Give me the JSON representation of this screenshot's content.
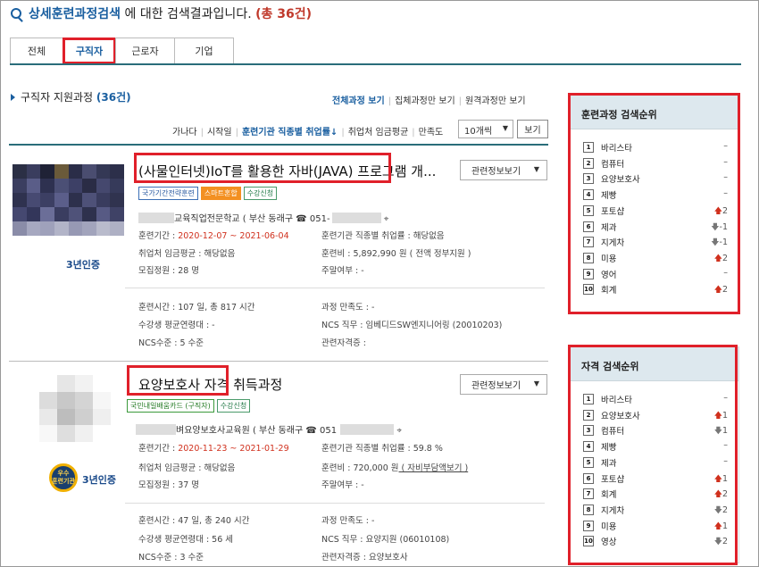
{
  "header": {
    "keyword": "상세훈련과정검색",
    "middle": " 에 대한 검색결과입니다. ",
    "count": "(총 36건)"
  },
  "tabs": [
    {
      "label": "전체"
    },
    {
      "label": "구직자"
    },
    {
      "label": "근로자"
    },
    {
      "label": "기업"
    }
  ],
  "section": {
    "title_prefix": "구직자 지원과정 ",
    "title_count": "(36건)"
  },
  "view_links": {
    "all": "전체과정 보기",
    "group": "집체과정만 보기",
    "remote": "원격과정만 보기"
  },
  "sort_links": {
    "items": [
      "가나다",
      "시작일",
      "훈련기관 직종별 취업률↓",
      "취업처 임금평균",
      "만족도"
    ],
    "page_size": "10개씩",
    "view_button": "보기"
  },
  "results": [
    {
      "title": "(사물인터넷)IoT를 활용한 자바(JAVA) 프로그램 개...",
      "related_button": "관련정보보기",
      "tags": [
        "국가기간전략훈련",
        "스마트혼합",
        "수강신청"
      ],
      "inst": "교육직업전문학교 ( 부산 동래구 ☎ 051-",
      "cert": "3년인증",
      "period_label": "훈련기간 : ",
      "period": "2020-12-07 ~ 2021-06-04",
      "employ_label": "훈련기관 직종별 취업률 : ",
      "employ": "해당없음",
      "wage": "취업처 임금평균 : 해당없음",
      "fee_label": "훈련비 : ",
      "fee": "5,892,990 원",
      "fee_note": " ( 전액 정부지원 )",
      "capacity": "모집정원 : 28 명",
      "weekend": "주말여부 : -",
      "hours": "훈련시간 : 107 일, 총 817 시간",
      "satisfaction": "과정 만족도 : -",
      "age": "수강생 평균연령대 : -",
      "ncs_job": "NCS 직무 : 임베디드SW엔지니어링 (20010203)",
      "ncs_level": "NCS수준 : 5 수준",
      "license": "관련자격증 :"
    },
    {
      "title": "요양보호사 자격 취득과정",
      "related_button": "관련정보보기",
      "tags": [
        "국민내일배움카드 (구직자)",
        "수강신청"
      ],
      "inst": "벼요양보호사교육원 ( 부산 동래구 ☎ 051",
      "cert": "3년인증",
      "seal": "우수\n훈련기관",
      "period_label": "훈련기간 : ",
      "period": "2020-11-23 ~ 2021-01-29",
      "employ_label": "훈련기관 직종별 취업률 : ",
      "employ": "59.8 %",
      "wage": "취업처 임금평균 : 해당없음",
      "fee_label": "훈련비 : ",
      "fee": "720,000 원",
      "fee_note": " ( 자비부담액보기 )",
      "capacity": "모집정원 : 37 명",
      "weekend": "주말여부 : -",
      "hours": "훈련시간 : 47 일, 총 240 시간",
      "satisfaction": "과정 만족도 : -",
      "age": "수강생 평균연령대 : 56 세",
      "ncs_job": "NCS 직무 : 요양지원 (06010108)",
      "ncs_level": "NCS수준 : 3 수준",
      "license": "관련자격증 : 요양보호사"
    }
  ],
  "course_rank": {
    "title": "훈련과정 검색순위",
    "items": [
      {
        "n": "1",
        "name": "바리스타",
        "chg": "–",
        "dir": "none"
      },
      {
        "n": "2",
        "name": "컴퓨터",
        "chg": "–",
        "dir": "none"
      },
      {
        "n": "3",
        "name": "요양보호사",
        "chg": "–",
        "dir": "none"
      },
      {
        "n": "4",
        "name": "제빵",
        "chg": "–",
        "dir": "none"
      },
      {
        "n": "5",
        "name": "포토샵",
        "chg": "2",
        "dir": "up"
      },
      {
        "n": "6",
        "name": "제과",
        "chg": "-1",
        "dir": "dn"
      },
      {
        "n": "7",
        "name": "지게차",
        "chg": "-1",
        "dir": "dn"
      },
      {
        "n": "8",
        "name": "미용",
        "chg": "2",
        "dir": "up"
      },
      {
        "n": "9",
        "name": "영어",
        "chg": "–",
        "dir": "none"
      },
      {
        "n": "10",
        "name": "회계",
        "chg": "2",
        "dir": "up"
      }
    ]
  },
  "cert_rank": {
    "title": "자격 검색순위",
    "items": [
      {
        "n": "1",
        "name": "바리스타",
        "chg": "–",
        "dir": "none"
      },
      {
        "n": "2",
        "name": "요양보호사",
        "chg": "1",
        "dir": "up"
      },
      {
        "n": "3",
        "name": "컴퓨터",
        "chg": "1",
        "dir": "dn"
      },
      {
        "n": "4",
        "name": "제빵",
        "chg": "–",
        "dir": "none"
      },
      {
        "n": "5",
        "name": "제과",
        "chg": "–",
        "dir": "none"
      },
      {
        "n": "6",
        "name": "포토샵",
        "chg": "1",
        "dir": "up"
      },
      {
        "n": "7",
        "name": "회계",
        "chg": "2",
        "dir": "up"
      },
      {
        "n": "8",
        "name": "지게차",
        "chg": "2",
        "dir": "dn"
      },
      {
        "n": "9",
        "name": "미용",
        "chg": "1",
        "dir": "up"
      },
      {
        "n": "10",
        "name": "영상",
        "chg": "2",
        "dir": "dn"
      }
    ]
  },
  "colors": {
    "accent": "#1a5fa0",
    "highlight": "#e0202a",
    "tabline": "#2a6d7a"
  }
}
